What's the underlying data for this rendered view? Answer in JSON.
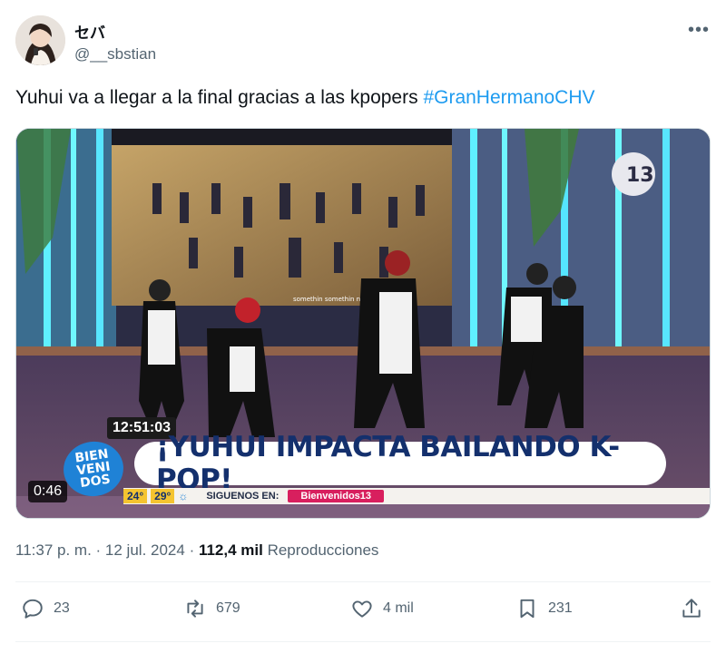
{
  "author": {
    "display_name": "セバ",
    "handle": "@__sbstian"
  },
  "tweet": {
    "text": "Yuhui va a llegar a la final gracias a las kpopers ",
    "hashtag": "#GranHermanoCHV"
  },
  "video": {
    "clock": "12:51:03",
    "banner": "¡YUHUI IMPACTA BAILANDO K-POP!",
    "logo_lines": [
      "BIEN",
      "VENI",
      "DOS"
    ],
    "temp_min": "24°",
    "temp_max": "29°",
    "follow_label": "SIGUENOS EN:",
    "channel": "Bienvenidos13",
    "screen_text": "somethin somethin new",
    "duration": "0:46"
  },
  "meta": {
    "time": "11:37 p. m.",
    "date": "12 jul. 2024",
    "views_count": "112,4 mil",
    "views_label": "Reproducciones"
  },
  "actions": {
    "replies": "23",
    "reposts": "679",
    "likes": "4 mil",
    "bookmarks": "231"
  },
  "colors": {
    "accent": "#1d9bf0",
    "secondary_text": "#536471",
    "banner_text": "#14306d"
  }
}
